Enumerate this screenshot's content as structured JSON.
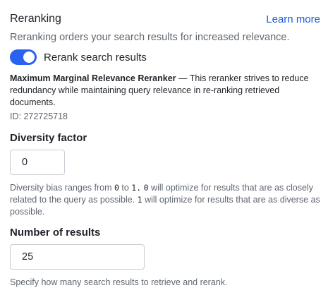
{
  "section": {
    "title": "Reranking",
    "learn_more": "Learn more",
    "description": "Reranking orders your search results for increased relevance."
  },
  "toggle": {
    "label": "Rerank search results",
    "checked": true,
    "color": "#2962ef"
  },
  "reranker": {
    "name": "Maximum Marginal Relevance Reranker",
    "separator": " — ",
    "description": "This reranker strives to reduce redundancy while maintaining query relevance in re-ranking retrieved documents.",
    "id_text": "ID: 272725718"
  },
  "diversity": {
    "label": "Diversity factor",
    "value": "0",
    "help_prefix": "Diversity bias ranges from ",
    "help_code_min": "0",
    "help_to": " to ",
    "help_code_max": "1.",
    "help_space": " ",
    "help_code_zero": "0",
    "help_mid": " will optimize for results that are as closely related to the query as possible. ",
    "help_code_one": "1",
    "help_end": " will optimize for results that are as diverse as possible."
  },
  "results": {
    "label": "Number of results",
    "value": "25",
    "help": "Specify how many search results to retrieve and rerank."
  },
  "colors": {
    "link": "#1a5bd6",
    "text": "#1f2329",
    "muted": "#606770",
    "border": "#c9cdd3"
  }
}
